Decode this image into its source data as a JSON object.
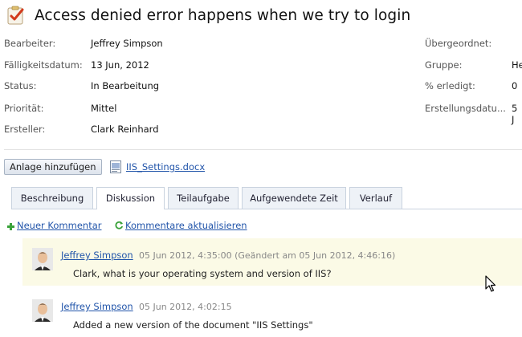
{
  "task": {
    "title": "Access denied error happens when we try to login"
  },
  "fields_left": [
    {
      "label": "Bearbeiter:",
      "value": "Jeffrey Simpson"
    },
    {
      "label": "Fälligkeitsdatum:",
      "value": "13 Jun, 2012"
    },
    {
      "label": "Status:",
      "value": "In Bearbeitung"
    },
    {
      "label": "Priorität:",
      "value": "Mittel"
    },
    {
      "label": "Ersteller:",
      "value": "Clark Reinhard"
    }
  ],
  "fields_right": [
    {
      "label": "Übergeordnet:",
      "value": ""
    },
    {
      "label": "Gruppe:",
      "value": "He"
    },
    {
      "label": "% erledigt:",
      "value": "0"
    },
    {
      "label": "Erstellungsdatu...",
      "value": "5 J"
    }
  ],
  "attachments": {
    "add_button": "Anlage hinzufügen",
    "file_name": "IIS_Settings.docx"
  },
  "tabs": [
    "Beschreibung",
    "Diskussion",
    "Teilaufgabe",
    "Aufgewendete Zeit",
    "Verlauf"
  ],
  "actions": {
    "new_comment": "Neuer Kommentar",
    "refresh_comments": "Kommentare aktualisieren"
  },
  "comments": [
    {
      "author": "Jeffrey Simpson",
      "meta": "05 Jun 2012, 4:35:00 (Geändert am 05 Jun 2012, 4:46:16)",
      "text": "Clark, what is your operating system and version of IIS?"
    },
    {
      "author": "Jeffrey Simpson",
      "meta": "05 Jun 2012, 4:02:15",
      "text": "Added a new version of the document \"IIS Settings\""
    }
  ],
  "colors": {
    "link": "#2255aa",
    "highlight_comment": "#fbfae6",
    "tab_border": "#c9d3df"
  }
}
